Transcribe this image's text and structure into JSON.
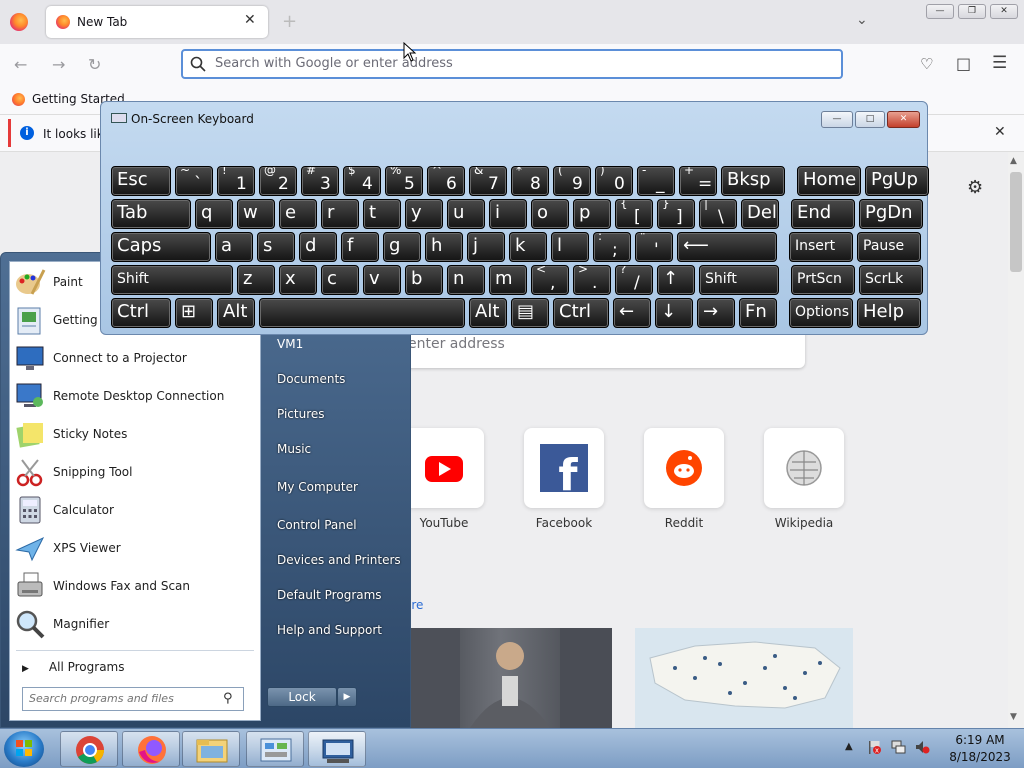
{
  "browser": {
    "tab_title": "New Tab",
    "tab_close": "✕",
    "new_tab": "+",
    "url_placeholder": "Search with Google or enter address",
    "bookmark": "Getting Started",
    "notification": "It looks like",
    "notification_close": "✕",
    "content_search_placeholder": "enter address",
    "top_sites": [
      {
        "label": "YouTube"
      },
      {
        "label": "Facebook"
      },
      {
        "label": "Reddit"
      },
      {
        "label": "Wikipedia"
      }
    ],
    "stories_link": "ore",
    "colors": {
      "accent": "#0060df",
      "url_focus": "#5b8fd8"
    }
  },
  "start_menu": {
    "programs": [
      {
        "label": "Paint",
        "icon": "paint-icon"
      },
      {
        "label": "Getting St",
        "icon": "getting-started-icon"
      },
      {
        "label": "Connect to a Projector",
        "icon": "projector-icon"
      },
      {
        "label": "Remote Desktop Connection",
        "icon": "remote-desktop-icon"
      },
      {
        "label": "Sticky Notes",
        "icon": "sticky-notes-icon"
      },
      {
        "label": "Snipping Tool",
        "icon": "snipping-tool-icon"
      },
      {
        "label": "Calculator",
        "icon": "calculator-icon"
      },
      {
        "label": "XPS Viewer",
        "icon": "xps-viewer-icon"
      },
      {
        "label": "Windows Fax and Scan",
        "icon": "fax-scan-icon"
      },
      {
        "label": "Magnifier",
        "icon": "magnifier-icon"
      }
    ],
    "all_programs": "All Programs",
    "search_placeholder": "Search programs and files",
    "user": "VM1",
    "links": [
      "Documents",
      "Pictures",
      "Music",
      "My Computer",
      "Control Panel",
      "Devices and Printers",
      "Default Programs",
      "Help and Support"
    ],
    "lock": "Lock"
  },
  "osk": {
    "title": "On-Screen Keyboard",
    "rows": [
      [
        "Esc",
        "~ `",
        "! 1",
        "@ 2",
        "# 3",
        "$ 4",
        "% 5",
        "^ 6",
        "& 7",
        "* 8",
        "( 9",
        ") 0",
        "- _",
        "+ =",
        "Bksp",
        "Home",
        "PgUp"
      ],
      [
        "Tab",
        "q",
        "w",
        "e",
        "r",
        "t",
        "y",
        "u",
        "i",
        "o",
        "p",
        "{ [",
        "} ]",
        "| \\",
        "Del",
        "End",
        "PgDn"
      ],
      [
        "Caps",
        "a",
        "s",
        "d",
        "f",
        "g",
        "h",
        "j",
        "k",
        "l",
        ": ;",
        "\" '",
        "⟵",
        "Insert",
        "Pause"
      ],
      [
        "Shift",
        "z",
        "x",
        "c",
        "v",
        "b",
        "n",
        "m",
        "< ,",
        "> .",
        "? /",
        "↑",
        "Shift",
        "PrtScn",
        "ScrLk"
      ],
      [
        "Ctrl",
        "⊞",
        "Alt",
        "",
        "Alt",
        "▤",
        "Ctrl",
        "←",
        "↓",
        "→",
        "Fn",
        "Options",
        "Help"
      ]
    ]
  },
  "taskbar": {
    "time": "6:19 AM",
    "date": "8/18/2023"
  }
}
